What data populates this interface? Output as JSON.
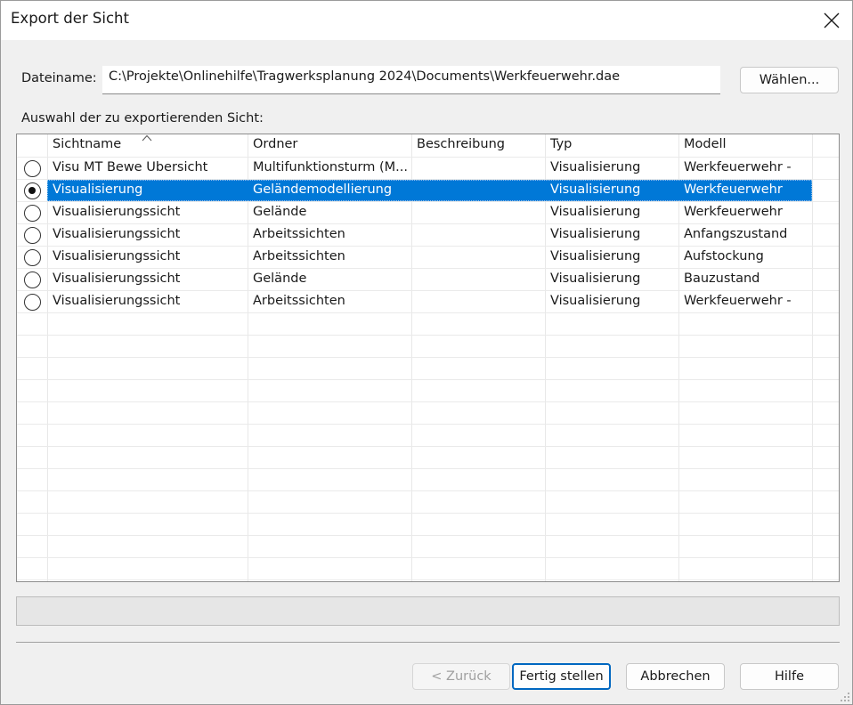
{
  "window": {
    "title": "Export der Sicht",
    "close_icon": "close-icon"
  },
  "file": {
    "label": "Dateiname:",
    "value": "C:\\Projekte\\Onlinehilfe\\Tragwerksplanung 2024\\Documents\\Werkfeuerwehr.dae",
    "choose_label": "Wählen..."
  },
  "selection_label": "Auswahl der zu exportierenden Sicht:",
  "table": {
    "columns": [
      "Sichtname",
      "Ordner",
      "Beschreibung",
      "Typ",
      "Modell"
    ],
    "sorted_column": "Sichtname",
    "rows": [
      {
        "name": "Visu MT Bewe Übersicht",
        "folder": "Multifunktionsturm (M...",
        "description": "",
        "type": "Visualisierung",
        "model": "Werkfeuerwehr -",
        "selected": false
      },
      {
        "name": "Visualisierung",
        "folder": "Geländemodellierung",
        "description": "",
        "type": "Visualisierung",
        "model": "Werkfeuerwehr",
        "selected": true
      },
      {
        "name": "Visualisierungssicht",
        "folder": "Gelände",
        "description": "",
        "type": "Visualisierung",
        "model": "Werkfeuerwehr",
        "selected": false
      },
      {
        "name": "Visualisierungssicht",
        "folder": "Arbeitssichten",
        "description": "",
        "type": "Visualisierung",
        "model": "Anfangszustand",
        "selected": false
      },
      {
        "name": "Visualisierungssicht",
        "folder": "Arbeitssichten",
        "description": "",
        "type": "Visualisierung",
        "model": "Aufstockung",
        "selected": false
      },
      {
        "name": "Visualisierungssicht",
        "folder": "Gelände",
        "description": "",
        "type": "Visualisierung",
        "model": "Bauzustand",
        "selected": false
      },
      {
        "name": "Visualisierungssicht",
        "folder": "Arbeitssichten",
        "description": "",
        "type": "Visualisierung",
        "model": "Werkfeuerwehr -",
        "selected": false
      }
    ]
  },
  "buttons": {
    "back": "< Zurück",
    "finish": "Fertig stellen",
    "cancel": "Abbrechen",
    "help": "Hilfe"
  },
  "colors": {
    "selection": "#0078d7",
    "accent_border": "#0067c0"
  }
}
